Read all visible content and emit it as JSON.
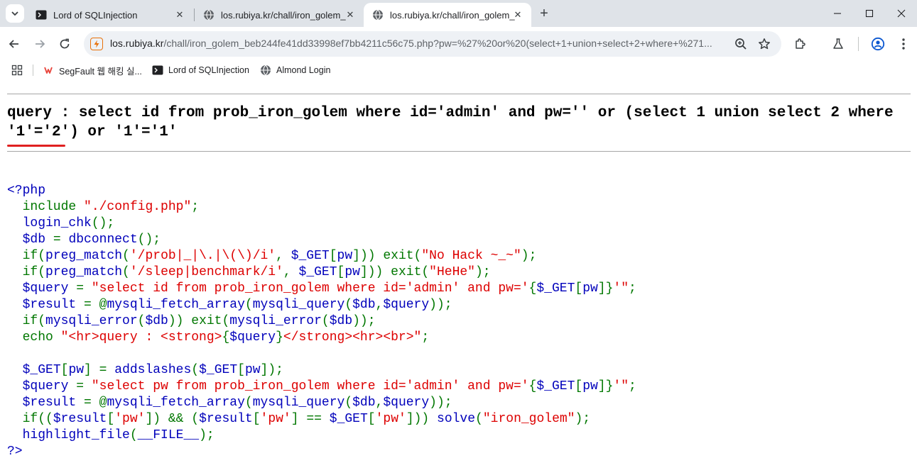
{
  "browser": {
    "tabs": [
      {
        "title": "Lord of SQLInjection",
        "favicon": "terminal-icon",
        "active": false
      },
      {
        "title": "los.rubiya.kr/chall/iron_golem_",
        "favicon": "globe-icon",
        "active": false
      },
      {
        "title": "los.rubiya.kr/chall/iron_golem_",
        "favicon": "globe-icon",
        "active": true
      }
    ],
    "url_host": "los.rubiya.kr",
    "url_rest": "/chall/iron_golem_beb244fe41dd33998ef7bb4211c56c75.php?pw=%27%20or%20(select+1+union+select+2+where+%271...",
    "bookmarks": [
      {
        "label": "SegFault 웹 해킹 실...",
        "icon": "segfault-logo-icon"
      },
      {
        "label": "Lord of SQLInjection",
        "icon": "terminal-icon"
      },
      {
        "label": "Almond Login",
        "icon": "globe-icon"
      }
    ]
  },
  "page": {
    "query_line1": "query : select id from prob_iron_golem where id='admin' and pw='' or (select 1 union select 2 where",
    "query_line2": "'1'='2') or '1'='1'",
    "highlight_color": "#e02020",
    "syntax_colors": {
      "default": "#0000bb",
      "keyword": "#007700",
      "string": "#dd0000"
    },
    "code_lines": [
      [
        [
          "default",
          "<?php"
        ]
      ],
      [
        [
          "keyword",
          "  include "
        ],
        [
          "string",
          "\"./config.php\""
        ],
        [
          "keyword",
          ";"
        ]
      ],
      [
        [
          "keyword",
          "  "
        ],
        [
          "default",
          "login_chk"
        ],
        [
          "keyword",
          "();"
        ]
      ],
      [
        [
          "keyword",
          "  "
        ],
        [
          "default",
          "$db "
        ],
        [
          "keyword",
          "= "
        ],
        [
          "default",
          "dbconnect"
        ],
        [
          "keyword",
          "();"
        ]
      ],
      [
        [
          "keyword",
          "  if("
        ],
        [
          "default",
          "preg_match"
        ],
        [
          "keyword",
          "("
        ],
        [
          "string",
          "'/prob|_|\\.|\\(\\)/i'"
        ],
        [
          "keyword",
          ", "
        ],
        [
          "default",
          "$_GET"
        ],
        [
          "keyword",
          "["
        ],
        [
          "default",
          "pw"
        ],
        [
          "keyword",
          "])) exit("
        ],
        [
          "string",
          "\"No Hack ~_~\""
        ],
        [
          "keyword",
          ");"
        ]
      ],
      [
        [
          "keyword",
          "  if("
        ],
        [
          "default",
          "preg_match"
        ],
        [
          "keyword",
          "("
        ],
        [
          "string",
          "'/sleep|benchmark/i'"
        ],
        [
          "keyword",
          ", "
        ],
        [
          "default",
          "$_GET"
        ],
        [
          "keyword",
          "["
        ],
        [
          "default",
          "pw"
        ],
        [
          "keyword",
          "])) exit("
        ],
        [
          "string",
          "\"HeHe\""
        ],
        [
          "keyword",
          ");"
        ]
      ],
      [
        [
          "keyword",
          "  "
        ],
        [
          "default",
          "$query "
        ],
        [
          "keyword",
          "= "
        ],
        [
          "string",
          "\"select id from prob_iron_golem where id='admin' and pw='"
        ],
        [
          "keyword",
          "{"
        ],
        [
          "default",
          "$_GET"
        ],
        [
          "keyword",
          "["
        ],
        [
          "default",
          "pw"
        ],
        [
          "keyword",
          "]}"
        ],
        [
          "string",
          "'\""
        ],
        [
          "keyword",
          ";"
        ]
      ],
      [
        [
          "keyword",
          "  "
        ],
        [
          "default",
          "$result "
        ],
        [
          "keyword",
          "= @"
        ],
        [
          "default",
          "mysqli_fetch_array"
        ],
        [
          "keyword",
          "("
        ],
        [
          "default",
          "mysqli_query"
        ],
        [
          "keyword",
          "("
        ],
        [
          "default",
          "$db"
        ],
        [
          "keyword",
          ","
        ],
        [
          "default",
          "$query"
        ],
        [
          "keyword",
          "));"
        ]
      ],
      [
        [
          "keyword",
          "  if("
        ],
        [
          "default",
          "mysqli_error"
        ],
        [
          "keyword",
          "("
        ],
        [
          "default",
          "$db"
        ],
        [
          "keyword",
          ")) exit("
        ],
        [
          "default",
          "mysqli_error"
        ],
        [
          "keyword",
          "("
        ],
        [
          "default",
          "$db"
        ],
        [
          "keyword",
          "));"
        ]
      ],
      [
        [
          "keyword",
          "  echo "
        ],
        [
          "string",
          "\"<hr>query : <strong>"
        ],
        [
          "keyword",
          "{"
        ],
        [
          "default",
          "$query"
        ],
        [
          "keyword",
          "}"
        ],
        [
          "string",
          "</strong><hr><br>\""
        ],
        [
          "keyword",
          ";"
        ]
      ],
      [
        [
          "keyword",
          ""
        ]
      ],
      [
        [
          "keyword",
          "  "
        ],
        [
          "default",
          "$_GET"
        ],
        [
          "keyword",
          "["
        ],
        [
          "default",
          "pw"
        ],
        [
          "keyword",
          "] = "
        ],
        [
          "default",
          "addslashes"
        ],
        [
          "keyword",
          "("
        ],
        [
          "default",
          "$_GET"
        ],
        [
          "keyword",
          "["
        ],
        [
          "default",
          "pw"
        ],
        [
          "keyword",
          "]);"
        ]
      ],
      [
        [
          "keyword",
          "  "
        ],
        [
          "default",
          "$query "
        ],
        [
          "keyword",
          "= "
        ],
        [
          "string",
          "\"select pw from prob_iron_golem where id='admin' and pw='"
        ],
        [
          "keyword",
          "{"
        ],
        [
          "default",
          "$_GET"
        ],
        [
          "keyword",
          "["
        ],
        [
          "default",
          "pw"
        ],
        [
          "keyword",
          "]}"
        ],
        [
          "string",
          "'\""
        ],
        [
          "keyword",
          ";"
        ]
      ],
      [
        [
          "keyword",
          "  "
        ],
        [
          "default",
          "$result "
        ],
        [
          "keyword",
          "= @"
        ],
        [
          "default",
          "mysqli_fetch_array"
        ],
        [
          "keyword",
          "("
        ],
        [
          "default",
          "mysqli_query"
        ],
        [
          "keyword",
          "("
        ],
        [
          "default",
          "$db"
        ],
        [
          "keyword",
          ","
        ],
        [
          "default",
          "$query"
        ],
        [
          "keyword",
          "));"
        ]
      ],
      [
        [
          "keyword",
          "  if(("
        ],
        [
          "default",
          "$result"
        ],
        [
          "keyword",
          "["
        ],
        [
          "string",
          "'pw'"
        ],
        [
          "keyword",
          "]) && ("
        ],
        [
          "default",
          "$result"
        ],
        [
          "keyword",
          "["
        ],
        [
          "string",
          "'pw'"
        ],
        [
          "keyword",
          "] == "
        ],
        [
          "default",
          "$_GET"
        ],
        [
          "keyword",
          "["
        ],
        [
          "string",
          "'pw'"
        ],
        [
          "keyword",
          "])) "
        ],
        [
          "default",
          "solve"
        ],
        [
          "keyword",
          "("
        ],
        [
          "string",
          "\"iron_golem\""
        ],
        [
          "keyword",
          ");"
        ]
      ],
      [
        [
          "keyword",
          "  "
        ],
        [
          "default",
          "highlight_file"
        ],
        [
          "keyword",
          "("
        ],
        [
          "default",
          "__FILE__"
        ],
        [
          "keyword",
          ");"
        ]
      ],
      [
        [
          "default",
          "?>"
        ]
      ]
    ]
  }
}
